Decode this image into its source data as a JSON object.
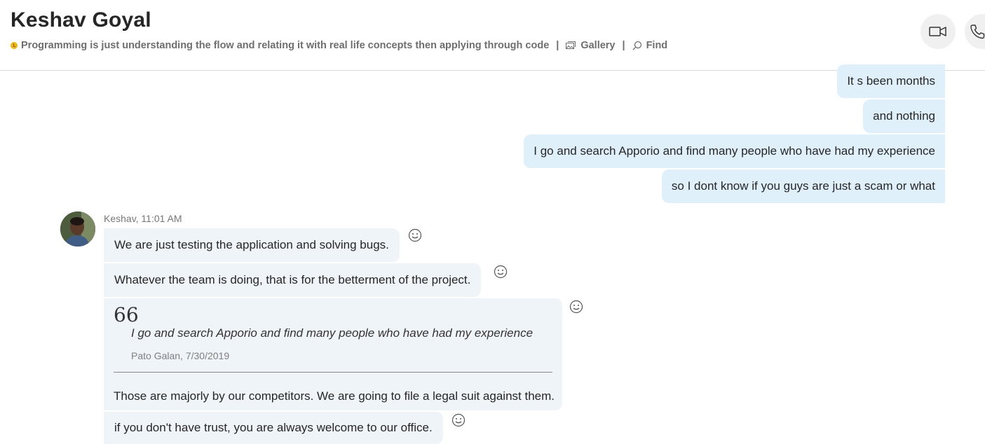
{
  "header": {
    "title": "Keshav Goyal",
    "mood": "Programming is just understanding the flow and relating it with real life concepts then applying through code",
    "separator": "|",
    "gallery_label": "Gallery",
    "find_label": "Find"
  },
  "outgoing": [
    {
      "text": "It s been months"
    },
    {
      "text": "and nothing"
    },
    {
      "text": "I go and search Apporio and find many people who have had my experience"
    },
    {
      "text": "so I dont know if you guys are just a scam or what"
    }
  ],
  "incoming": {
    "sender": "Keshav, 11:01 AM",
    "messages": [
      {
        "text": "We are just testing the application and solving bugs."
      },
      {
        "text": "Whatever the team is doing, that is for the betterment of the project."
      }
    ],
    "quoted": {
      "mark": "66",
      "text": "I go and search Apporio and find many people who have had my experience",
      "author": "Pato Galan, 7/30/2019",
      "reply": "Those are majorly by our competitors. We are going to file a legal suit against them."
    },
    "last": {
      "text": "if you don't have trust, you are always welcome to our office."
    }
  },
  "colors": {
    "outgoing_bubble": "#dff0fa",
    "incoming_bubble": "#eef4f8",
    "status_away": "#f2b707"
  },
  "icons": {
    "status": "away-status-icon",
    "gallery": "gallery-icon",
    "find": "search-icon",
    "video": "video-call-icon",
    "audio": "phone-call-icon",
    "react": "smiley-icon"
  }
}
